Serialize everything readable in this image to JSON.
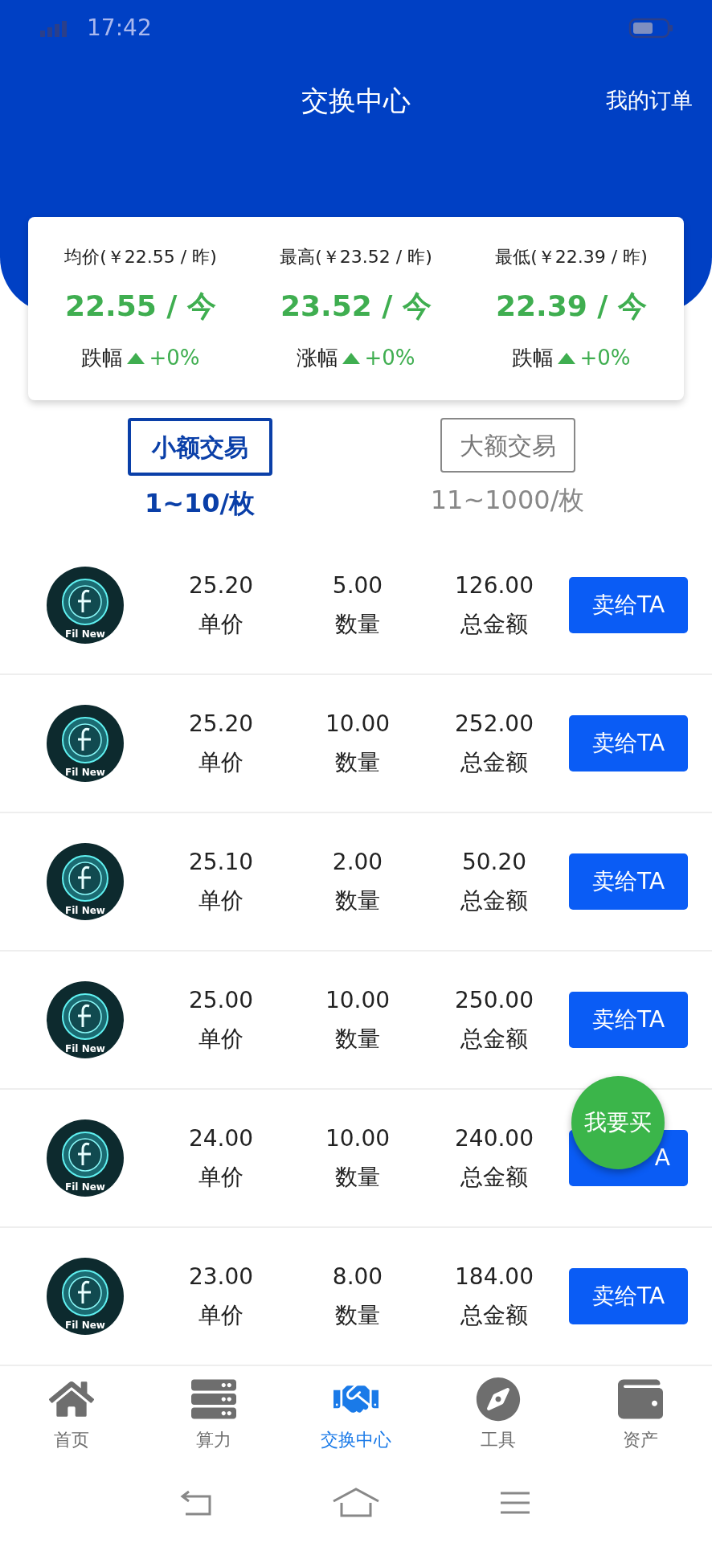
{
  "status_bar": {
    "time": "17:42"
  },
  "header": {
    "title": "交换中心",
    "action": "我的订单"
  },
  "stats": [
    {
      "label": "均价(￥22.55 / 昨)",
      "value": "22.55 / 今",
      "change_label": "跌幅",
      "change": "+0%"
    },
    {
      "label": "最高(￥23.52 / 昨)",
      "value": "23.52 / 今",
      "change_label": "涨幅",
      "change": "+0%"
    },
    {
      "label": "最低(￥22.39 / 昨)",
      "value": "22.39 / 今",
      "change_label": "跌幅",
      "change": "+0%"
    }
  ],
  "tabs": [
    {
      "label": "小额交易",
      "range": "1~10/枚",
      "selected": true
    },
    {
      "label": "大额交易",
      "range": "11~1000/枚",
      "selected": false
    }
  ],
  "orders": [
    {
      "logo_text": "Fil New",
      "price": "25.20",
      "price_label": "单价",
      "quantity": "5.00",
      "quantity_label": "数量",
      "total": "126.00",
      "total_label": "总金额",
      "button": "卖给TA",
      "partly_covered": false
    },
    {
      "logo_text": "Fil New",
      "price": "25.20",
      "price_label": "单价",
      "quantity": "10.00",
      "quantity_label": "数量",
      "total": "252.00",
      "total_label": "总金额",
      "button": "卖给TA",
      "partly_covered": false
    },
    {
      "logo_text": "Fil New",
      "price": "25.10",
      "price_label": "单价",
      "quantity": "2.00",
      "quantity_label": "数量",
      "total": "50.20",
      "total_label": "总金额",
      "button": "卖给TA",
      "partly_covered": false
    },
    {
      "logo_text": "Fil New",
      "price": "25.00",
      "price_label": "单价",
      "quantity": "10.00",
      "quantity_label": "数量",
      "total": "250.00",
      "total_label": "总金额",
      "button": "卖给TA",
      "partly_covered": false
    },
    {
      "logo_text": "Fil New",
      "price": "24.00",
      "price_label": "单价",
      "quantity": "10.00",
      "quantity_label": "数量",
      "total": "240.00",
      "total_label": "总金额",
      "button": "A",
      "partly_covered": true
    },
    {
      "logo_text": "Fil New",
      "price": "23.00",
      "price_label": "单价",
      "quantity": "8.00",
      "quantity_label": "数量",
      "total": "184.00",
      "total_label": "总金额",
      "button": "卖给TA",
      "partly_covered": false
    }
  ],
  "floating_button": "我要买",
  "nav": [
    {
      "label": "首页",
      "kind": "home",
      "selected": false
    },
    {
      "label": "算力",
      "kind": "server",
      "selected": false
    },
    {
      "label": "交换中心",
      "kind": "exchange",
      "selected": true
    },
    {
      "label": "工具",
      "kind": "compass",
      "selected": false
    },
    {
      "label": "资产",
      "kind": "wallet",
      "selected": false
    }
  ]
}
